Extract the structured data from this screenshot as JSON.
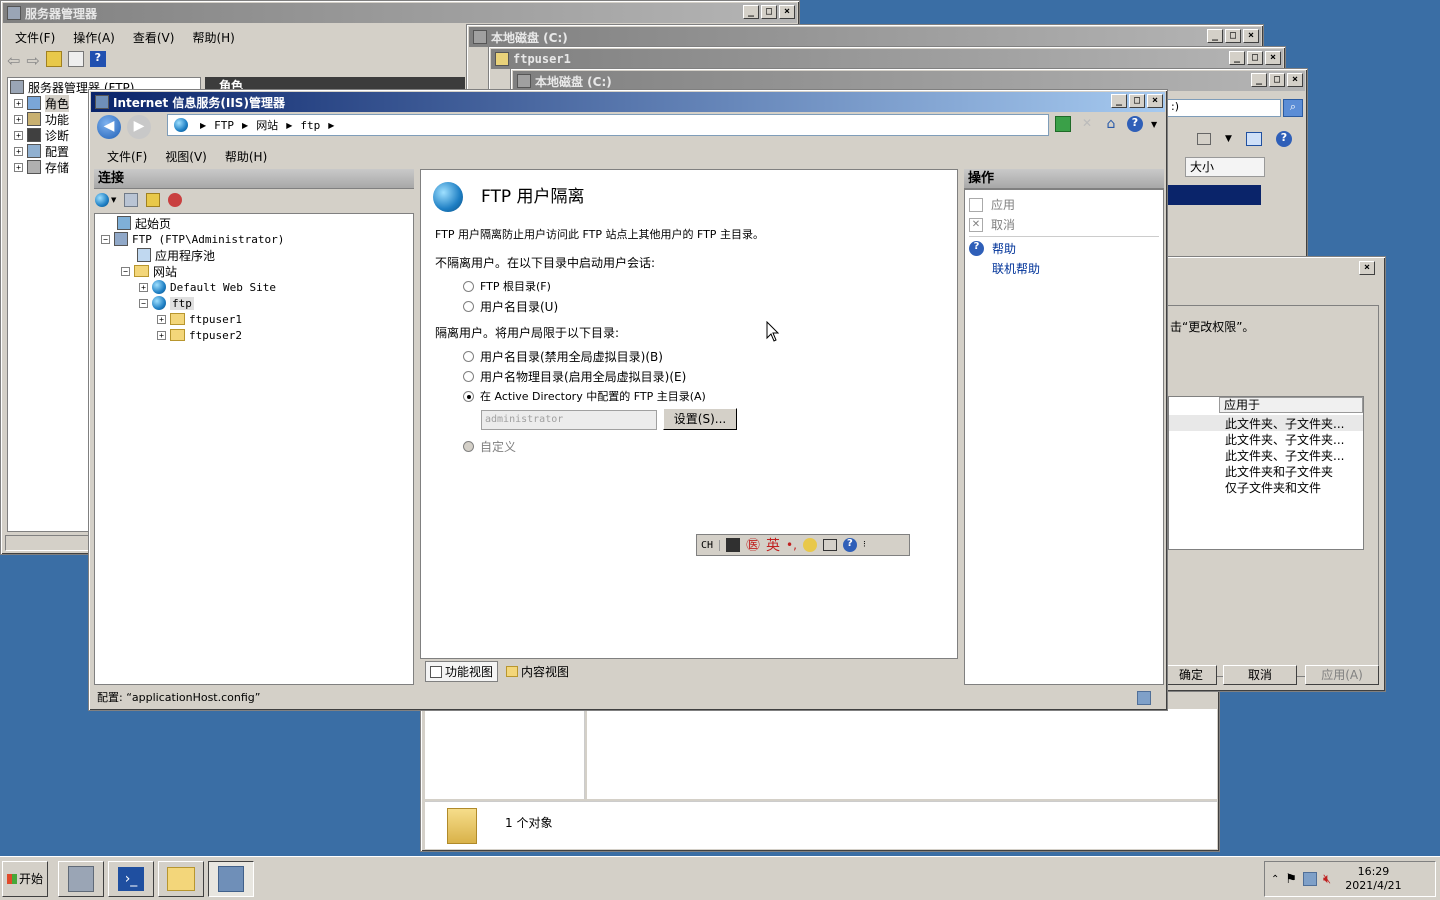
{
  "server_manager": {
    "title": "服务器管理器",
    "menu": [
      "文件(F)",
      "操作(A)",
      "查看(V)",
      "帮助(H)"
    ],
    "tree_root": "服务器管理器 (FTP)",
    "tree_items": [
      "角色",
      "功能",
      "诊断",
      "配置",
      "存储"
    ],
    "right_header": "角色"
  },
  "explorer_back1": {
    "title": "本地磁盘 (C:)"
  },
  "explorer_back2": {
    "title": "ftpuser1"
  },
  "explorer_back3": {
    "title": "本地磁盘 (C:)",
    "address_tail": ":)",
    "col_size": "大小",
    "status_count": "1 个对象"
  },
  "permissions_dialog": {
    "text_tail": "击“更改权限”。",
    "col_applies": "应用于",
    "rows": [
      "此文件夹、子文件夹...",
      "此文件夹、子文件夹...",
      "此文件夹、子文件夹...",
      "此文件夹和子文件夹",
      "仅子文件夹和文件"
    ],
    "ok": "确定",
    "cancel": "取消",
    "apply": "应用(A)"
  },
  "iis": {
    "title": "Internet 信息服务(IIS)管理器",
    "breadcrumb": [
      "FTP",
      "网站",
      "ftp"
    ],
    "menu": [
      "文件(F)",
      "视图(V)",
      "帮助(H)"
    ],
    "connections_header": "连接",
    "tree": {
      "start_page": "起始页",
      "server": "FTP (FTP\\Administrator)",
      "app_pools": "应用程序池",
      "sites": "网站",
      "default_site": "Default Web Site",
      "ftp_site": "ftp",
      "user1": "ftpuser1",
      "user2": "ftpuser2"
    },
    "page_title": "FTP 用户隔离",
    "description": "FTP 用户隔离防止用户访问此 FTP 站点上其他用户的 FTP 主目录。",
    "no_isolate_label": "不隔离用户。在以下目录中启动用户会话:",
    "options_no_isolate": [
      "FTP 根目录(F)",
      "用户名目录(U)"
    ],
    "isolate_label": "隔离用户。将用户局限于以下目录:",
    "options_isolate": [
      "用户名目录(禁用全局虚拟目录)(B)",
      "用户名物理目录(启用全局虚拟目录)(E)",
      "在 Active Directory 中配置的 FTP 主目录(A)"
    ],
    "ad_user_value": "administrator",
    "settings_button": "设置(S)...",
    "custom_option": "自定义",
    "view_tabs": [
      "功能视图",
      "内容视图"
    ],
    "actions_header": "操作",
    "actions": {
      "apply": "应用",
      "cancel": "取消",
      "help": "帮助",
      "online_help": "联机帮助"
    },
    "status_config": "配置: “applicationHost.config”"
  },
  "ime_bar": {
    "lang": "CH",
    "mode": "英"
  },
  "taskbar": {
    "start_label": "开始",
    "time": "16:29",
    "date": "2021/4/21"
  }
}
